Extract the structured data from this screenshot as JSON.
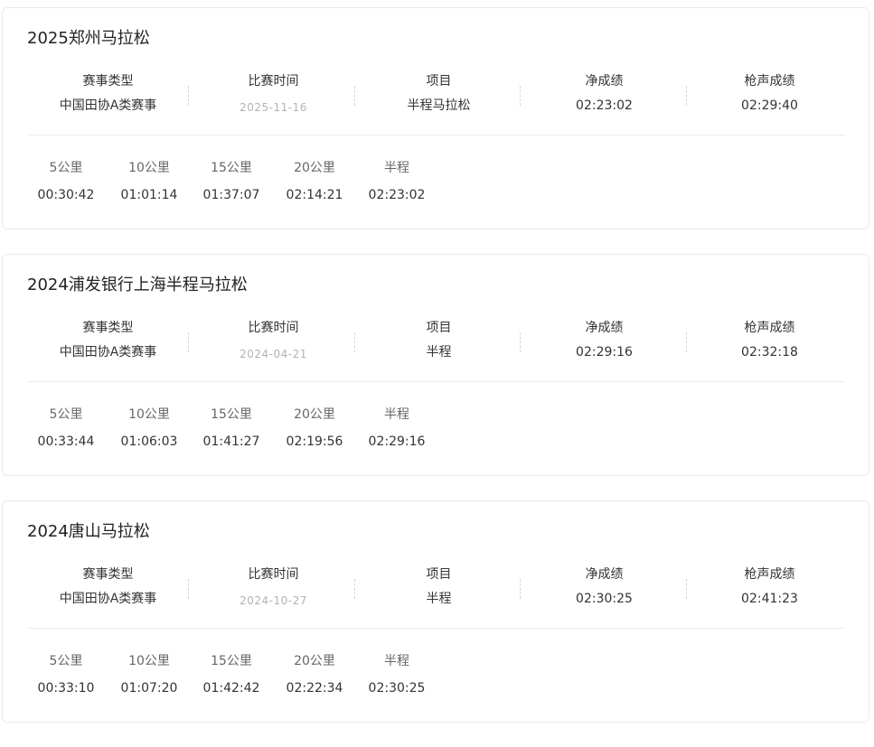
{
  "info_headers": {
    "type_label": "赛事类型",
    "date_label": "比赛时间",
    "event_label": "项目",
    "net_label": "净成绩",
    "gun_label": "枪声成绩"
  },
  "races": [
    {
      "title": "2025郑州马拉松",
      "race_type": "中国田协A类赛事",
      "date": "2025-11-16",
      "event": "半程马拉松",
      "net_time": "02:23:02",
      "gun_time": "02:29:40",
      "splits": [
        {
          "label": "5公里",
          "time": "00:30:42"
        },
        {
          "label": "10公里",
          "time": "01:01:14"
        },
        {
          "label": "15公里",
          "time": "01:37:07"
        },
        {
          "label": "20公里",
          "time": "02:14:21"
        },
        {
          "label": "半程",
          "time": "02:23:02"
        }
      ]
    },
    {
      "title": "2024浦发银行上海半程马拉松",
      "race_type": "中国田协A类赛事",
      "date": "2024-04-21",
      "event": "半程",
      "net_time": "02:29:16",
      "gun_time": "02:32:18",
      "splits": [
        {
          "label": "5公里",
          "time": "00:33:44"
        },
        {
          "label": "10公里",
          "time": "01:06:03"
        },
        {
          "label": "15公里",
          "time": "01:41:27"
        },
        {
          "label": "20公里",
          "time": "02:19:56"
        },
        {
          "label": "半程",
          "time": "02:29:16"
        }
      ]
    },
    {
      "title": "2024唐山马拉松",
      "race_type": "中国田协A类赛事",
      "date": "2024-10-27",
      "event": "半程",
      "net_time": "02:30:25",
      "gun_time": "02:41:23",
      "splits": [
        {
          "label": "5公里",
          "time": "00:33:10"
        },
        {
          "label": "10公里",
          "time": "01:07:20"
        },
        {
          "label": "15公里",
          "time": "01:42:42"
        },
        {
          "label": "20公里",
          "time": "02:22:34"
        },
        {
          "label": "半程",
          "time": "02:30:25"
        }
      ]
    }
  ]
}
